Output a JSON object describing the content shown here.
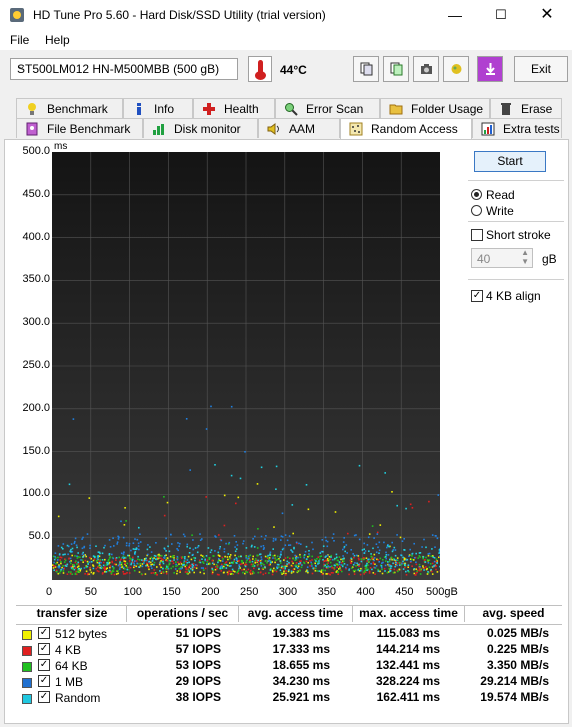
{
  "window": {
    "title": "HD Tune Pro 5.60 - Hard Disk/SSD Utility (trial version)"
  },
  "menu": {
    "file": "File",
    "help": "Help"
  },
  "toolbar": {
    "drive": "ST500LM012 HN-M500MBB (500 gB)",
    "temperature": "44°C",
    "exit": "Exit",
    "buttons": [
      "copy-icon",
      "copy-all-icon",
      "camera-icon",
      "bug-icon",
      "download-icon"
    ]
  },
  "tabs_top": [
    {
      "label": "Benchmark",
      "icon": "bulb-icon"
    },
    {
      "label": "Info",
      "icon": "info-icon"
    },
    {
      "label": "Health",
      "icon": "health-icon"
    },
    {
      "label": "Error Scan",
      "icon": "magnifier-icon"
    },
    {
      "label": "Folder Usage",
      "icon": "folder-icon"
    },
    {
      "label": "Erase",
      "icon": "trash-icon"
    }
  ],
  "tabs_bottom": [
    {
      "label": "File Benchmark",
      "icon": "file-bench-icon"
    },
    {
      "label": "Disk monitor",
      "icon": "monitor-icon"
    },
    {
      "label": "AAM",
      "icon": "speaker-icon"
    },
    {
      "label": "Random Access",
      "icon": "random-icon",
      "active": true
    },
    {
      "label": "Extra tests",
      "icon": "extra-icon"
    }
  ],
  "chart_data": {
    "type": "scatter",
    "ylabel": "ms",
    "xlabel": "gB",
    "xlim": [
      0,
      500
    ],
    "ylim": [
      0,
      500
    ],
    "y_ticks": [
      "500.0",
      "450.0",
      "400.0",
      "350.0",
      "300.0",
      "250.0",
      "200.0",
      "150.0",
      "100.0",
      "50.0"
    ],
    "x_ticks": [
      "0",
      "50",
      "100",
      "150",
      "200",
      "250",
      "300",
      "350",
      "400",
      "450",
      "500gB"
    ],
    "series": [
      {
        "name": "512 bytes",
        "color": "#f0f000",
        "values_ms_avg": 19.383
      },
      {
        "name": "4 KB",
        "color": "#e02020",
        "values_ms_avg": 17.333
      },
      {
        "name": "64 KB",
        "color": "#20c020",
        "values_ms_avg": 18.655
      },
      {
        "name": "1 MB",
        "color": "#2080e0",
        "values_ms_avg": 34.23
      },
      {
        "name": "Random",
        "color": "#20d0e0",
        "values_ms_avg": 25.921
      }
    ]
  },
  "side": {
    "start": "Start",
    "read": "Read",
    "write": "Write",
    "short_stroke": "Short stroke",
    "stroke_value": "40",
    "stroke_unit": "gB",
    "align": "4 KB align"
  },
  "results": {
    "headers": [
      "transfer size",
      "operations / sec",
      "avg. access time",
      "max. access time",
      "avg. speed"
    ],
    "rows": [
      {
        "name": "512 bytes",
        "color": "#f0f000",
        "ops": "51 IOPS",
        "avg": "19.383 ms",
        "max": "115.083 ms",
        "speed": "0.025 MB/s"
      },
      {
        "name": "4 KB",
        "color": "#e02020",
        "ops": "57 IOPS",
        "avg": "17.333 ms",
        "max": "144.214 ms",
        "speed": "0.225 MB/s"
      },
      {
        "name": "64 KB",
        "color": "#20c020",
        "ops": "53 IOPS",
        "avg": "18.655 ms",
        "max": "132.441 ms",
        "speed": "3.350 MB/s"
      },
      {
        "name": "1 MB",
        "color": "#2070d0",
        "ops": "29 IOPS",
        "avg": "34.230 ms",
        "max": "328.224 ms",
        "speed": "29.214 MB/s"
      },
      {
        "name": "Random",
        "color": "#20c8e0",
        "ops": "38 IOPS",
        "avg": "25.921 ms",
        "max": "162.411 ms",
        "speed": "19.574 MB/s"
      }
    ]
  }
}
